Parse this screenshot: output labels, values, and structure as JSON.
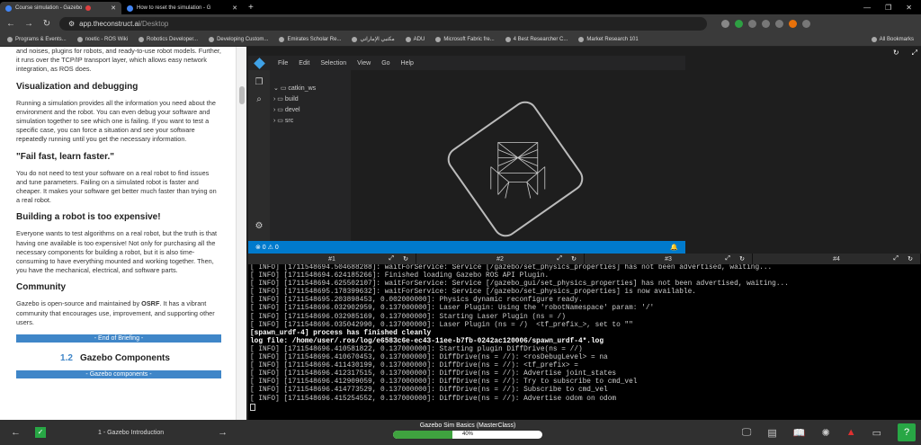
{
  "browser": {
    "tabs": [
      {
        "title": "Course simulation - Gazebo",
        "active": true
      },
      {
        "title": "How to reset the simulation - G",
        "active": false
      }
    ],
    "url_host": "app.theconstruct.ai",
    "url_path": "/Desktop",
    "bookmarks": [
      "Programs & Events...",
      "noetic - ROS Wiki",
      "Robotics Developer...",
      "Developing Custom...",
      "Emirates Scholar Re...",
      "مكتبي الإماراتي",
      "ADU",
      "Microsoft Fabric fre...",
      "4 Best Researcher C...",
      "Market Research 101"
    ],
    "all_bookmarks": "All Bookmarks"
  },
  "article": {
    "intro": "and noises, plugins for robots, and ready-to-use robot models. Further, it runs over the TCP/IP transport layer, which allows easy network integration, as ROS does.",
    "h1": "Visualization and debugging",
    "p1": "Running a simulation provides all the information you need about the environment and the robot. You can even debug your software and simulation together to see which one is failing. If you want to test a specific case, you can force a situation and see your software repeatedly running until you get the necessary information.",
    "h2": "\"Fail fast, learn faster.\"",
    "p2": "You do not need to test your software on a real robot to find issues and tune parameters. Failing on a simulated robot is faster and cheaper. It makes your software get better much faster than trying on a real robot.",
    "h3": "Building a robot is too expensive!",
    "p3": "Everyone wants to test algorithms on a real robot, but the truth is that having one available is too expensive! Not only for purchasing all the necessary components for building a robot, but it is also time-consuming to have everything mounted and working together. Then, you have the mechanical, electrical, and software parts.",
    "h4": "Community",
    "p4_pre": "Gazebo is open-source and maintained by ",
    "p4_bold": "OSRF",
    "p4_post": ". It has a vibrant community that encourages use, improvement, and supporting other users.",
    "end_banner": "- End of Briefing -",
    "section_num": "1.2",
    "section_title": "Gazebo Components",
    "comp_banner": "- Gazebo components -"
  },
  "vscode": {
    "menu": [
      "File",
      "Edit",
      "Selection",
      "View",
      "Go",
      "Help"
    ],
    "root": "catkin_ws",
    "folders": [
      "build",
      "devel",
      "src"
    ],
    "status": "⊗ 0 ⚠ 0"
  },
  "terminal_tabs": [
    "#1",
    "#2",
    "#3",
    "#4"
  ],
  "terminal_lines": [
    {
      "t": "[ INFO] [1711548694.504688288]: waitForService: Service [/gazebo/set_physics_properties] has not been advertised, waiting...",
      "b": false
    },
    {
      "t": "[ INFO] [1711548694.624185266]: Finished loading Gazebo ROS API Plugin.",
      "b": false
    },
    {
      "t": "[ INFO] [1711548694.625502107]: waitForService: Service [/gazebo_gui/set_physics_properties] has not been advertised, waiting...",
      "b": false
    },
    {
      "t": "[ INFO] [1711548695.178399632]: waitForService: Service [/gazebo/set_physics_properties] is now available.",
      "b": false
    },
    {
      "t": "[ INFO] [1711548695.203898453, 0.002000000]: Physics dynamic reconfigure ready.",
      "b": false
    },
    {
      "t": "[ INFO] [1711548696.032902959, 0.137000000]: Laser Plugin: Using the 'robotNamespace' param: '/'",
      "b": false
    },
    {
      "t": "[ INFO] [1711548696.032985169, 0.137000000]: Starting Laser Plugin (ns = /)",
      "b": false
    },
    {
      "t": "[ INFO] [1711548696.035042990, 0.137000000]: Laser Plugin (ns = /)  <tf_prefix_>, set to \"\"",
      "b": false
    },
    {
      "t": "[spawn_urdf-4] process has finished cleanly",
      "b": true
    },
    {
      "t": "log file: /home/user/.ros/log/e6583c6e-ec43-11ee-b7fb-0242ac120006/spawn_urdf-4*.log",
      "b": true
    },
    {
      "t": "[ INFO] [1711548696.410581822, 0.137000000]: Starting plugin DiffDrive(ns = //)",
      "b": false
    },
    {
      "t": "[ INFO] [1711548696.410670453, 0.137000000]: DiffDrive(ns = //): <rosDebugLevel> = na",
      "b": false
    },
    {
      "t": "[ INFO] [1711548696.411430199, 0.137000000]: DiffDrive(ns = //): <tf_prefix> =",
      "b": false
    },
    {
      "t": "[ INFO] [1711548696.412317515, 0.137000000]: DiffDrive(ns = //): Advertise joint_states",
      "b": false
    },
    {
      "t": "[ INFO] [1711548696.412909059, 0.137000000]: DiffDrive(ns = //): Try to subscribe to cmd_vel",
      "b": false
    },
    {
      "t": "[ INFO] [1711548696.414773529, 0.137000000]: DiffDrive(ns = //): Subscribe to cmd_vel",
      "b": false
    },
    {
      "t": "[ INFO] [1711548696.415254552, 0.137000000]: DiffDrive(ns = //): Advertise odom on odom",
      "b": false
    }
  ],
  "bottom": {
    "unit": "1 - Gazebo Introduction",
    "course": "Gazebo Sim Basics (MasterClass)",
    "progress_text": "40%",
    "progress": 0.4
  }
}
